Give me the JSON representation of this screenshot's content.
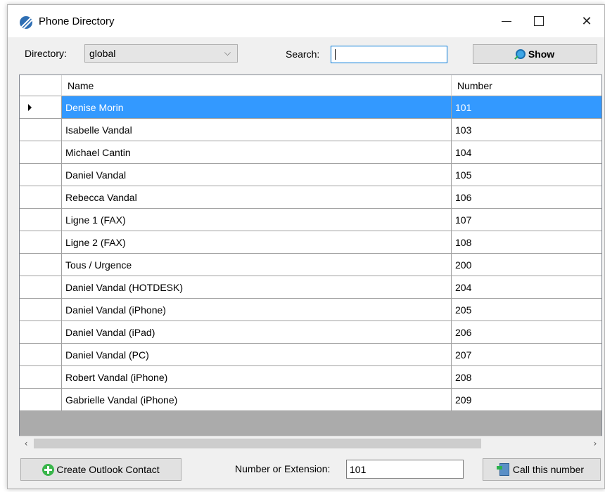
{
  "window": {
    "title": "Phone Directory",
    "controls": {
      "minimize": "",
      "maximize": "",
      "close": "✕"
    }
  },
  "toolbar": {
    "directory_label": "Directory:",
    "directory_value": "global",
    "search_label": "Search:",
    "search_value": "",
    "show_label": "Show"
  },
  "grid": {
    "columns": [
      "Name",
      "Number"
    ],
    "selected_index": 0,
    "rows": [
      {
        "name": "Denise Morin",
        "number": "101"
      },
      {
        "name": "Isabelle Vandal",
        "number": "103"
      },
      {
        "name": "Michael Cantin",
        "number": "104"
      },
      {
        "name": "Daniel Vandal",
        "number": "105"
      },
      {
        "name": "Rebecca Vandal",
        "number": "106"
      },
      {
        "name": "Ligne 1 (FAX)",
        "number": "107"
      },
      {
        "name": "Ligne 2 (FAX)",
        "number": "108"
      },
      {
        "name": "Tous / Urgence",
        "number": "200"
      },
      {
        "name": "Daniel Vandal (HOTDESK)",
        "number": "204"
      },
      {
        "name": "Daniel Vandal (iPhone)",
        "number": "205"
      },
      {
        "name": "Daniel Vandal (iPad)",
        "number": "206"
      },
      {
        "name": "Daniel Vandal (PC)",
        "number": "207"
      },
      {
        "name": "Robert Vandal (iPhone)",
        "number": "208"
      },
      {
        "name": "Gabrielle Vandal (iPhone)",
        "number": "209"
      }
    ]
  },
  "footer": {
    "create_contact_label": "Create Outlook Contact",
    "number_label": "Number or Extension:",
    "number_value": "101",
    "call_label": "Call this number"
  },
  "colors": {
    "selection": "#3399ff",
    "accent_border": "#0078d7"
  }
}
